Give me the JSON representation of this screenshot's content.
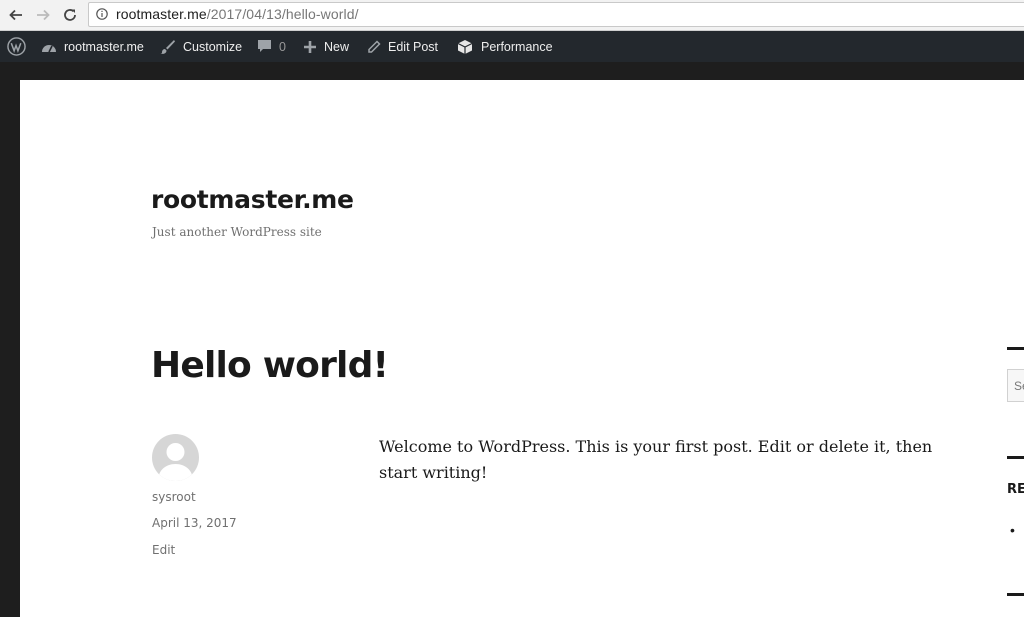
{
  "browser": {
    "url_host": "rootmaster.me",
    "url_path": "/2017/04/13/hello-world/"
  },
  "adminbar": {
    "site_name": "rootmaster.me",
    "customize": "Customize",
    "comments_count": "0",
    "new": "New",
    "edit_post": "Edit Post",
    "performance": "Performance"
  },
  "site": {
    "title": "rootmaster.me",
    "description": "Just another WordPress site"
  },
  "post": {
    "title": "Hello world!",
    "author": "sysroot",
    "date": "April 13, 2017",
    "edit": "Edit",
    "content": "Welcome to WordPress. This is your first post. Edit or delete it, then start writing!"
  },
  "sidebar": {
    "search_placeholder": "Se",
    "recent_heading": "RE"
  }
}
